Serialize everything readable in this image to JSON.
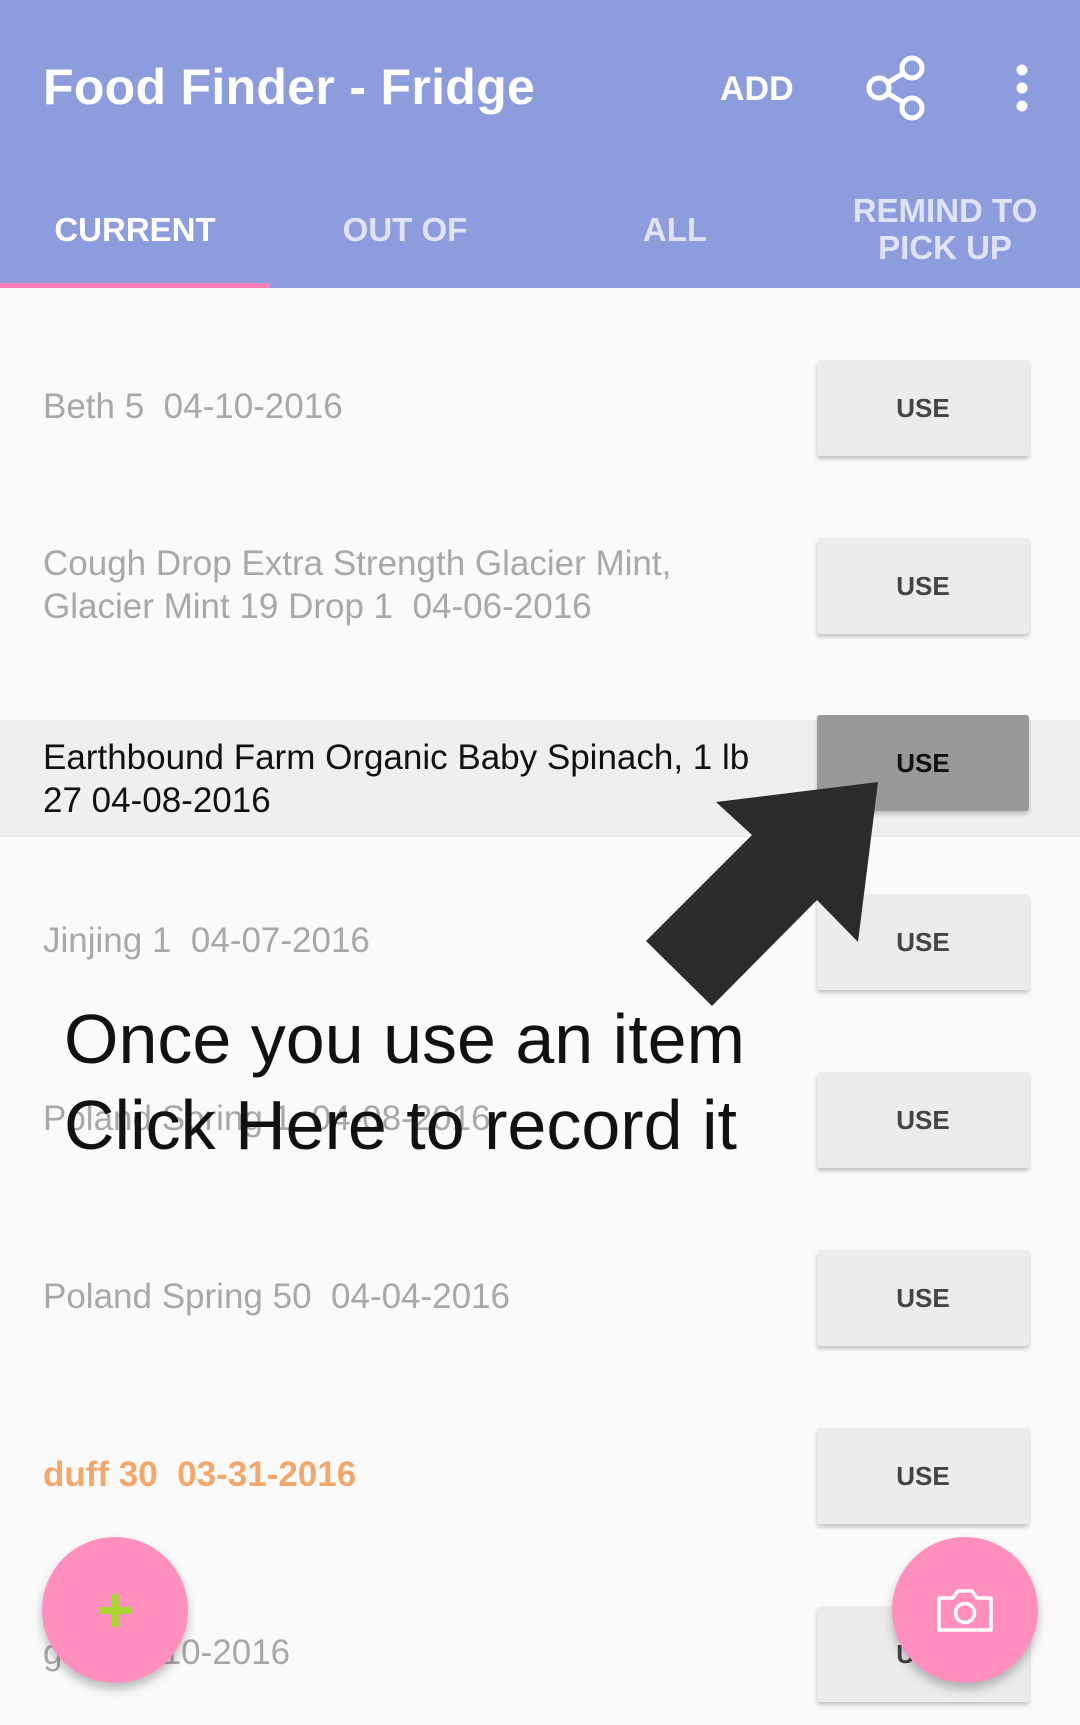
{
  "app_bar": {
    "title": "Food Finder - Fridge",
    "add_label": "ADD",
    "share_icon": "share-icon",
    "more_icon": "more-vert-icon",
    "background_color": "#8c9cdc"
  },
  "tabs": [
    {
      "label": "CURRENT",
      "active": true
    },
    {
      "label": "OUT OF",
      "active": false
    },
    {
      "label": "ALL",
      "active": false
    },
    {
      "label": "REMIND TO\nPICK UP",
      "active": false
    }
  ],
  "tab_indicator_color": "#ff80b5",
  "items": [
    {
      "text": "Beth 5  04-10-2016",
      "action": "USE"
    },
    {
      "text": "Cough Drop Extra Strength Glacier Mint,\nGlacier Mint 19 Drop 1  04-06-2016",
      "action": "USE"
    },
    {
      "text": "Earthbound Farm Organic Baby Spinach, 1 lb\n27 04-08-2016",
      "action": "USE",
      "highlighted": true
    },
    {
      "text": "Jinjing 1  04-07-2016",
      "action": "USE"
    },
    {
      "text": "Poland Spring 1  04-08-2016",
      "action": "USE"
    },
    {
      "text": "Poland Spring 50  04-04-2016",
      "action": "USE"
    },
    {
      "text": "duff 30  03-31-2016",
      "action": "USE",
      "overdue_color": "#f2a86d"
    },
    {
      "text": "gtg  04-10-2016",
      "action": "USE"
    }
  ],
  "annotation": {
    "line1": "Once you use an item",
    "line2": "Click Here to record it"
  },
  "fabs": {
    "add_icon": "plus-icon",
    "camera_icon": "camera-icon",
    "color": "#ff8fbd"
  }
}
